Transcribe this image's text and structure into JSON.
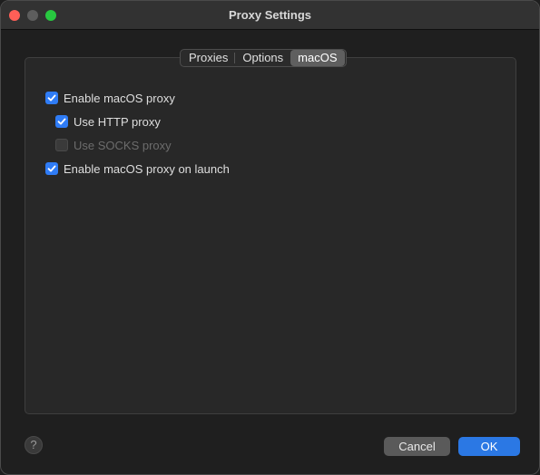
{
  "window": {
    "title": "Proxy Settings"
  },
  "tabs": [
    {
      "label": "Proxies",
      "active": false
    },
    {
      "label": "Options",
      "active": false
    },
    {
      "label": "macOS",
      "active": true
    }
  ],
  "options": {
    "enable_macos_proxy": {
      "label": "Enable macOS proxy",
      "checked": true,
      "enabled": true
    },
    "use_http_proxy": {
      "label": "Use HTTP proxy",
      "checked": true,
      "enabled": true
    },
    "use_socks_proxy": {
      "label": "Use SOCKS proxy",
      "checked": false,
      "enabled": false
    },
    "enable_on_launch": {
      "label": "Enable macOS proxy on launch",
      "checked": true,
      "enabled": true
    }
  },
  "footer": {
    "help_glyph": "?",
    "cancel_label": "Cancel",
    "ok_label": "OK"
  },
  "colors": {
    "accent": "#2f7cf6",
    "ok_button": "#2b78e4"
  }
}
